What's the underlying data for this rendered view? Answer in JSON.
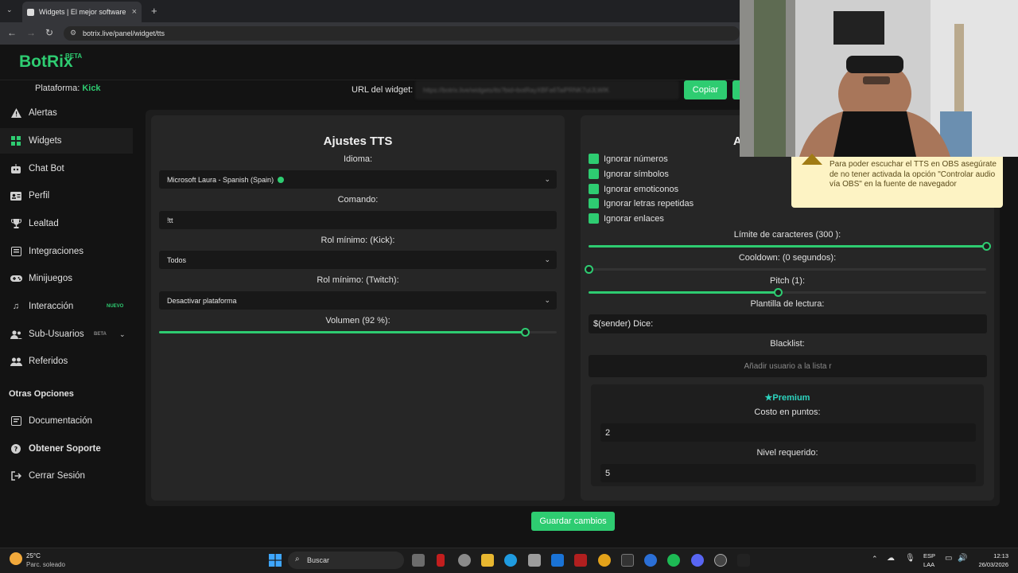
{
  "browser": {
    "tab_title": "Widgets | El mejor software pa",
    "url": "botrix.live/panel/widget/tts"
  },
  "app": {
    "brand": "BotRix",
    "brand_badge": "BETA",
    "platform_label": "Plataforma:",
    "platform_value": "Kick",
    "widget_url_label": "URL del widget:",
    "widget_url_value": "https://botrix.live/widgets/tts?bid=botRayXBFa6TaiPRNK7uIJLWIK",
    "copy_button": "Copiar",
    "save_button": "Guardar cambios",
    "accent_color": "#2ecc71"
  },
  "sidebar": {
    "items": [
      {
        "label": "Alertas",
        "icon": "warning-icon"
      },
      {
        "label": "Widgets",
        "icon": "grid-icon",
        "active": true
      },
      {
        "label": "Chat Bot",
        "icon": "robot-icon"
      },
      {
        "label": "Perfil",
        "icon": "id-card-icon"
      },
      {
        "label": "Lealtad",
        "icon": "trophy-icon"
      },
      {
        "label": "Integraciones",
        "icon": "plug-icon"
      },
      {
        "label": "Minijuegos",
        "icon": "gamepad-icon"
      },
      {
        "label": "Interacción",
        "icon": "music-icon",
        "badge": "NUEVO"
      },
      {
        "label": "Sub-Usuarios",
        "icon": "users-icon",
        "badge": "BETA"
      },
      {
        "label": "Referidos",
        "icon": "user-group-icon"
      }
    ],
    "other_title": "Otras Opciones",
    "other_items": [
      {
        "label": "Documentación",
        "icon": "document-icon"
      },
      {
        "label": "Obtener Soporte",
        "icon": "help-icon"
      },
      {
        "label": "Cerrar Sesión",
        "icon": "logout-icon"
      }
    ]
  },
  "tts": {
    "title": "Ajustes TTS",
    "language_label": "Idioma:",
    "language_value": "Microsoft Laura - Spanish (Spain)",
    "command_label": "Comando:",
    "command_value": "!tt",
    "min_role_kick_label": "Rol mínimo: (Kick):",
    "min_role_kick_value": "Todos",
    "min_role_twitch_label": "Rol mínimo: (Twitch):",
    "min_role_twitch_value": "Desactivar plataforma",
    "volume_label": "Volumen (92 %):",
    "volume_value": 92
  },
  "advanced": {
    "title_fragment": "A",
    "checkboxes": [
      {
        "label": "Ignorar números",
        "checked": true
      },
      {
        "label": "Ignorar símbolos",
        "checked": true
      },
      {
        "label": "Ignorar emoticonos",
        "checked": true
      },
      {
        "label": "Ignorar letras repetidas",
        "checked": true
      },
      {
        "label": "Ignorar enlaces",
        "checked": true
      }
    ],
    "char_limit_label": "Límite de caracteres (300 ):",
    "char_limit_fraction": 1.0,
    "cooldown_label": "Cooldown: (0 segundos):",
    "cooldown_fraction": 0.0,
    "pitch_label": "Pitch (1):",
    "pitch_fraction": 0.475,
    "template_label": "Plantilla de lectura:",
    "template_value": "$(sender) Dice:",
    "blacklist_label": "Blacklist:",
    "blacklist_placeholder": "Añadir usuario a la lista r",
    "premium_title": "Premium",
    "cost_label": "Costo en puntos:",
    "cost_value": "2",
    "level_label": "Nivel requerido:",
    "level_value": "5"
  },
  "warning": {
    "text": "Para poder escuchar el TTS en OBS asegúrate de no tener activada la opción \"Controlar audio vía OBS\" en la fuente de navegador"
  },
  "taskbar": {
    "temperature": "25°C",
    "weather": "Parc. soleado",
    "search": "Buscar",
    "lang_1": "ESP",
    "lang_2": "LAA",
    "time": "12:13",
    "date": "26/03/2026"
  }
}
